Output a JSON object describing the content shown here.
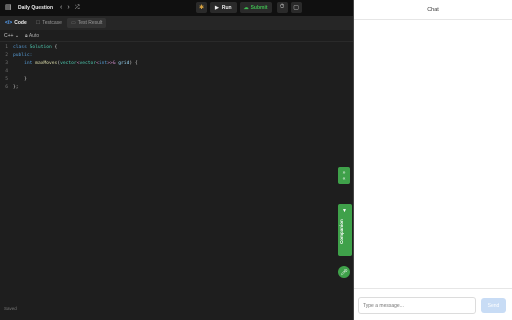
{
  "topbar": {
    "title": "Daily Question",
    "run_label": "Run",
    "submit_label": "Submit"
  },
  "tabs": [
    {
      "label": "Code"
    },
    {
      "label": "Testcase"
    },
    {
      "label": "Test Result"
    }
  ],
  "editor": {
    "language": "C++",
    "mode": "Auto",
    "line_numbers": [
      "1",
      "2",
      "3",
      "4",
      "5",
      "6"
    ],
    "code": {
      "l1_kw": "class",
      "l1_name": "Solution",
      "l1_rest": " {",
      "l2": "public:",
      "l3_type": "int",
      "l3_fn": "maxMoves",
      "l3_p1": "(",
      "l3_vec": "vector",
      "l3_lt": "<",
      "l3_vec2": "vector",
      "l3_lt2": "<",
      "l3_int": "int",
      "l3_gt": ">>&",
      "l3_arg": " grid",
      "l3_end": ") {",
      "l5": "}",
      "l6": "};"
    },
    "status": "Saved"
  },
  "side": {
    "companion_label": "Companion"
  },
  "chat": {
    "title": "Chat",
    "input_placeholder": "Type a message...",
    "send_label": "Send"
  }
}
